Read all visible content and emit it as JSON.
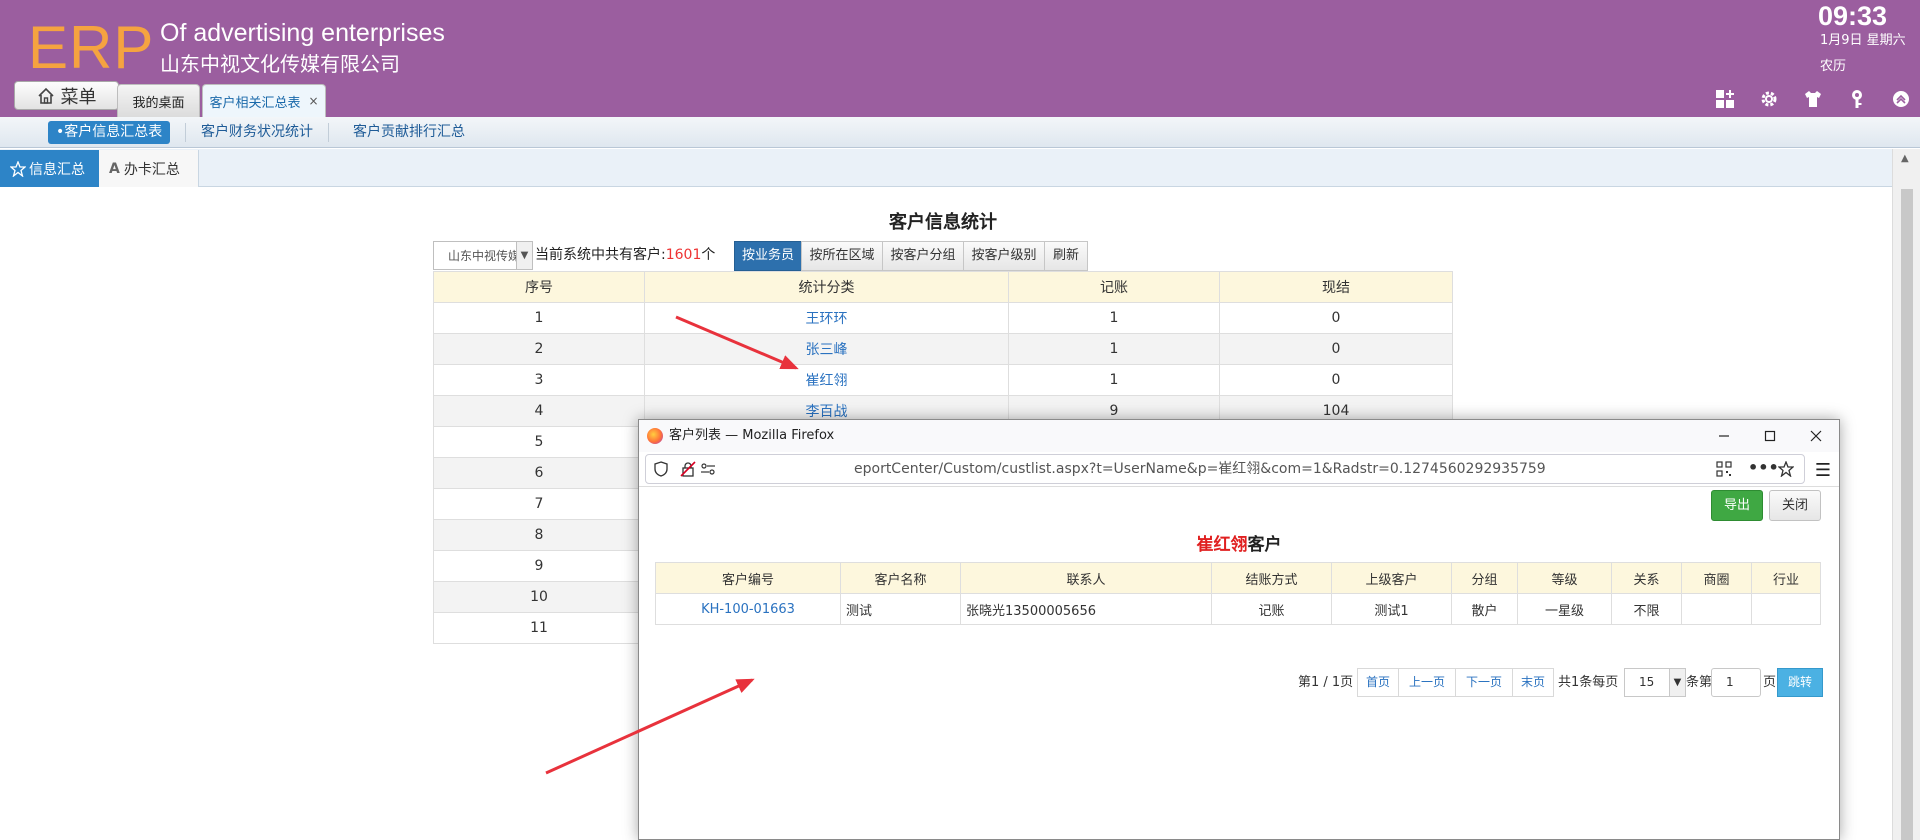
{
  "header": {
    "logo": "ERP",
    "slogan": "Of advertising enterprises",
    "company": "山东中视文化传媒有限公司",
    "time": "09:33",
    "date": "1月9日 星期六",
    "lunar": "农历",
    "menu_label": "菜单",
    "tabs": [
      {
        "label": "我的桌面"
      },
      {
        "label": "客户相关汇总表",
        "close": "×"
      }
    ],
    "icons": [
      "apps-icon",
      "gear-icon",
      "shirt-icon",
      "key-icon",
      "collapse-up-icon"
    ]
  },
  "subnav": {
    "items": [
      {
        "label": "•客户信息汇总表"
      },
      {
        "label": "客户财务状况统计"
      },
      {
        "label": "客户贡献排行汇总"
      }
    ]
  },
  "sidetabs": {
    "items": [
      {
        "label": "信息汇总"
      },
      {
        "label": "办卡汇总"
      }
    ]
  },
  "report": {
    "title": "客户信息统计",
    "company_select": "山东中视传媒",
    "count_prefix": "当前系统中共有客户:",
    "count_value": "1601",
    "count_suffix": "个",
    "buttons": [
      {
        "label": "按业务员"
      },
      {
        "label": "按所在区域"
      },
      {
        "label": "按客户分组"
      },
      {
        "label": "按客户级别"
      },
      {
        "label": "刷新"
      }
    ],
    "columns": [
      "序号",
      "统计分类",
      "记账",
      "现结"
    ],
    "rows": [
      [
        "1",
        "王环环",
        "1",
        "0"
      ],
      [
        "2",
        "张三峰",
        "1",
        "0"
      ],
      [
        "3",
        "崔红翎",
        "1",
        "0"
      ],
      [
        "4",
        "李百战",
        "9",
        "104"
      ],
      [
        "5",
        "",
        "",
        ""
      ],
      [
        "6",
        "",
        "",
        ""
      ],
      [
        "7",
        "",
        "",
        ""
      ],
      [
        "8",
        "",
        "",
        ""
      ],
      [
        "9",
        "",
        "",
        ""
      ],
      [
        "10",
        "",
        "",
        ""
      ],
      [
        "11",
        "",
        "",
        ""
      ]
    ]
  },
  "popup": {
    "window_title": "客户列表 — Mozilla Firefox",
    "url": "eportCenter/Custom/custlist.aspx?t=UserName&p=崔红翎&com=1&Radstr=0.1274560292935759",
    "export_label": "导出",
    "close_label": "关闭",
    "title_name": "崔红翎",
    "title_suffix": "客户",
    "columns": [
      "客户编号",
      "客户名称",
      "联系人",
      "结账方式",
      "上级客户",
      "分组",
      "等级",
      "关系",
      "商圈",
      "行业"
    ],
    "rows": [
      [
        "KH-100-01663",
        "测试",
        "张晓光13500005656",
        "记账",
        "测试1",
        "散户",
        "一星级",
        "不限",
        "",
        ""
      ]
    ],
    "pager": {
      "page_info": "第1 / 1页",
      "first": "首页",
      "prev": "上一页",
      "next": "下一页",
      "last": "末页",
      "total_text": "共1条每页",
      "page_size": "15",
      "goto_prefix": "条第",
      "goto_value": "1",
      "goto_suffix": "页",
      "jump_label": "跳转"
    }
  }
}
